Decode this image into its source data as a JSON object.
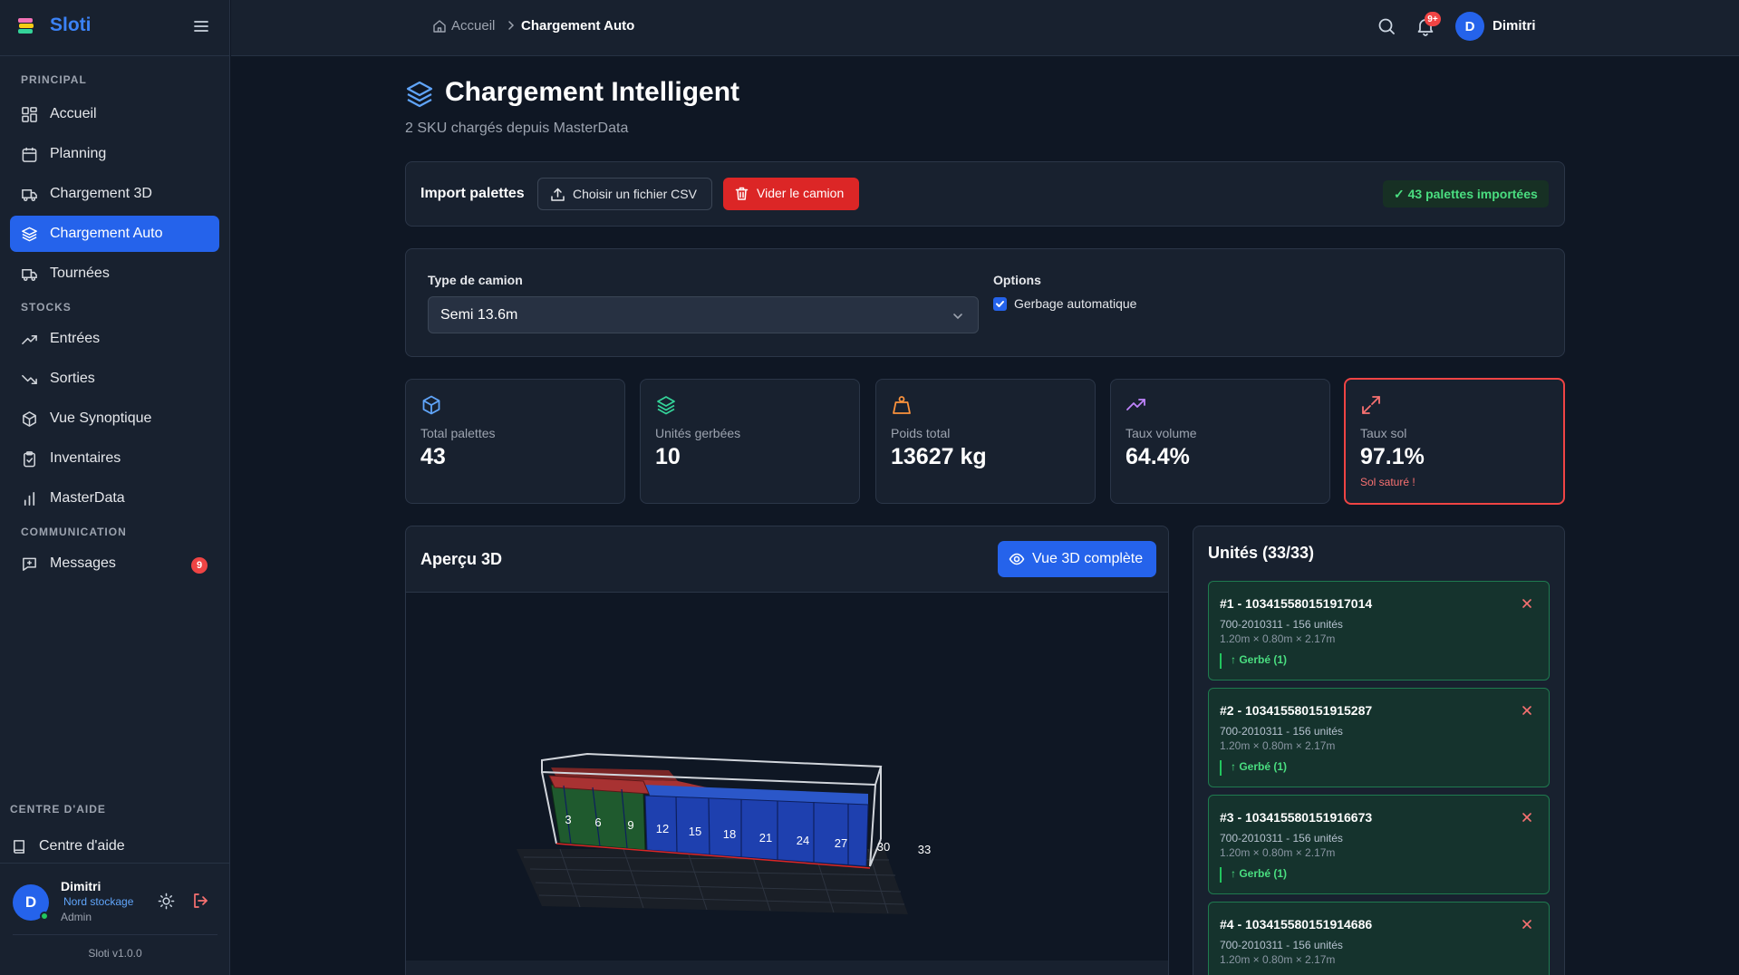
{
  "app": {
    "name": "Sloti",
    "version": "Sloti v1.0.0"
  },
  "sidebar": {
    "sections": {
      "principal": "PRINCIPAL",
      "stocks": "STOCKS",
      "communication": "COMMUNICATION",
      "help": "CENTRE D'AIDE"
    },
    "items": [
      {
        "label": "Accueil",
        "icon": "dashboard-icon"
      },
      {
        "label": "Planning",
        "icon": "calendar-icon"
      },
      {
        "label": "Chargement 3D",
        "icon": "truck-icon"
      },
      {
        "label": "Chargement Auto",
        "icon": "layers-icon",
        "active": true
      },
      {
        "label": "Tournées",
        "icon": "truck-icon"
      },
      {
        "label": "Entrées",
        "icon": "trend-up-icon"
      },
      {
        "label": "Sorties",
        "icon": "trend-down-icon"
      },
      {
        "label": "Vue Synoptique",
        "icon": "package-icon"
      },
      {
        "label": "Inventaires",
        "icon": "clipboard-icon"
      },
      {
        "label": "MasterData",
        "icon": "bar-chart-icon"
      },
      {
        "label": "Messages",
        "icon": "message-icon",
        "badge": "9"
      }
    ],
    "help_label": "Centre d'aide",
    "user": {
      "initial": "D",
      "name": "Dimitri",
      "site": "Nord stockage",
      "role": "Admin"
    }
  },
  "topbar": {
    "breadcrumb": {
      "home": "Accueil",
      "current": "Chargement Auto"
    },
    "notifications_badge": "9+",
    "user": {
      "initial": "D",
      "name": "Dimitri"
    }
  },
  "page": {
    "title": "Chargement Intelligent",
    "subtitle": "2 SKU chargés depuis MasterData"
  },
  "import": {
    "label": "Import palettes",
    "csv_button": "Choisir un fichier CSV",
    "clear_button": "Vider le camion",
    "status": "✓ 43 palettes importées"
  },
  "config": {
    "truck_label": "Type de camion",
    "truck_value": "Semi 13.6m",
    "options_label": "Options",
    "stacking_label": "Gerbage automatique",
    "stacking_checked": true
  },
  "stats": [
    {
      "label": "Total palettes",
      "value": "43",
      "icon": "box-icon",
      "color": "#60a5fa"
    },
    {
      "label": "Unités gerbées",
      "value": "10",
      "icon": "layers-icon",
      "color": "#34d399"
    },
    {
      "label": "Poids total",
      "value": "13627 kg",
      "icon": "weight-icon",
      "color": "#fb923c"
    },
    {
      "label": "Taux volume",
      "value": "64.4%",
      "icon": "trend-up-icon",
      "color": "#c084fc"
    },
    {
      "label": "Taux sol",
      "value": "97.1%",
      "icon": "expand-icon",
      "color": "#f87171",
      "warning": "Sol saturé !"
    }
  ],
  "preview": {
    "title": "Aperçu 3D",
    "button": "Vue 3D complète",
    "stack_labels": [
      "3",
      "6",
      "9"
    ],
    "unit_labels": [
      "12",
      "15",
      "18",
      "21",
      "24",
      "27",
      "30",
      "33"
    ],
    "colors": {
      "stacked": "#1f5a2e",
      "top_layer": "#a83232",
      "unit": "#1e40af"
    }
  },
  "units": {
    "title": "Unités (33/33)",
    "items": [
      {
        "title": "#1 - 103415580151917014",
        "sku": "700-2010311 - 156 unités",
        "dims": "1.20m × 0.80m × 2.17m",
        "tag": "↑ Gerbé (1)"
      },
      {
        "title": "#2 - 103415580151915287",
        "sku": "700-2010311 - 156 unités",
        "dims": "1.20m × 0.80m × 2.17m",
        "tag": "↑ Gerbé (1)"
      },
      {
        "title": "#3 - 103415580151916673",
        "sku": "700-2010311 - 156 unités",
        "dims": "1.20m × 0.80m × 2.17m",
        "tag": "↑ Gerbé (1)"
      },
      {
        "title": "#4 - 103415580151914686",
        "sku": "700-2010311 - 156 unités",
        "dims": "1.20m × 0.80m × 2.17m",
        "tag": ""
      }
    ]
  }
}
